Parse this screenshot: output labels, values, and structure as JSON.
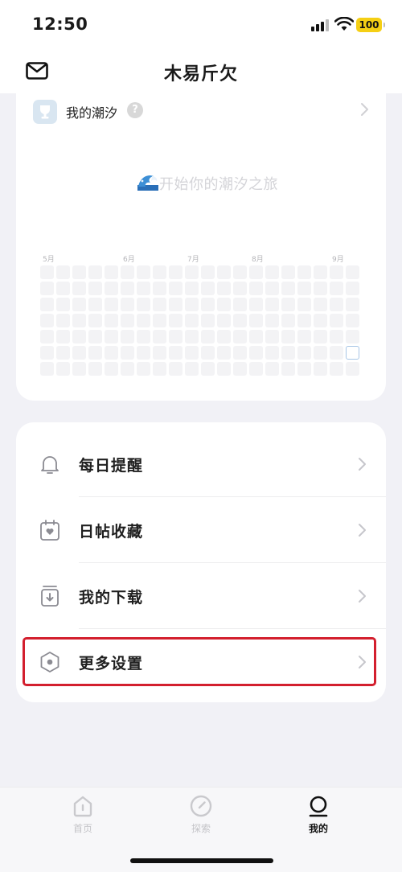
{
  "status_bar": {
    "time": "12:50",
    "battery": "100"
  },
  "header": {
    "title": "木易斤欠"
  },
  "tide_card": {
    "title": "我的潮汐",
    "help_glyph": "?",
    "empty_message": "开始你的潮汐之旅",
    "months": [
      "5月",
      "6月",
      "7月",
      "8月",
      "9月"
    ]
  },
  "menu": {
    "items": [
      {
        "label": "每日提醒",
        "icon": "bell-icon"
      },
      {
        "label": "日帖收藏",
        "icon": "calendar-heart-icon"
      },
      {
        "label": "我的下载",
        "icon": "download-box-icon"
      },
      {
        "label": "更多设置",
        "icon": "hexagon-settings-icon"
      }
    ]
  },
  "tab_bar": {
    "tabs": [
      {
        "label": "首页",
        "icon": "home-icon"
      },
      {
        "label": "探索",
        "icon": "compass-icon"
      },
      {
        "label": "我的",
        "icon": "profile-icon",
        "active": true
      }
    ]
  },
  "colors": {
    "accent": "#f5cf14",
    "highlight": "#d31f2e",
    "today_cell": "#a8c6e6"
  }
}
